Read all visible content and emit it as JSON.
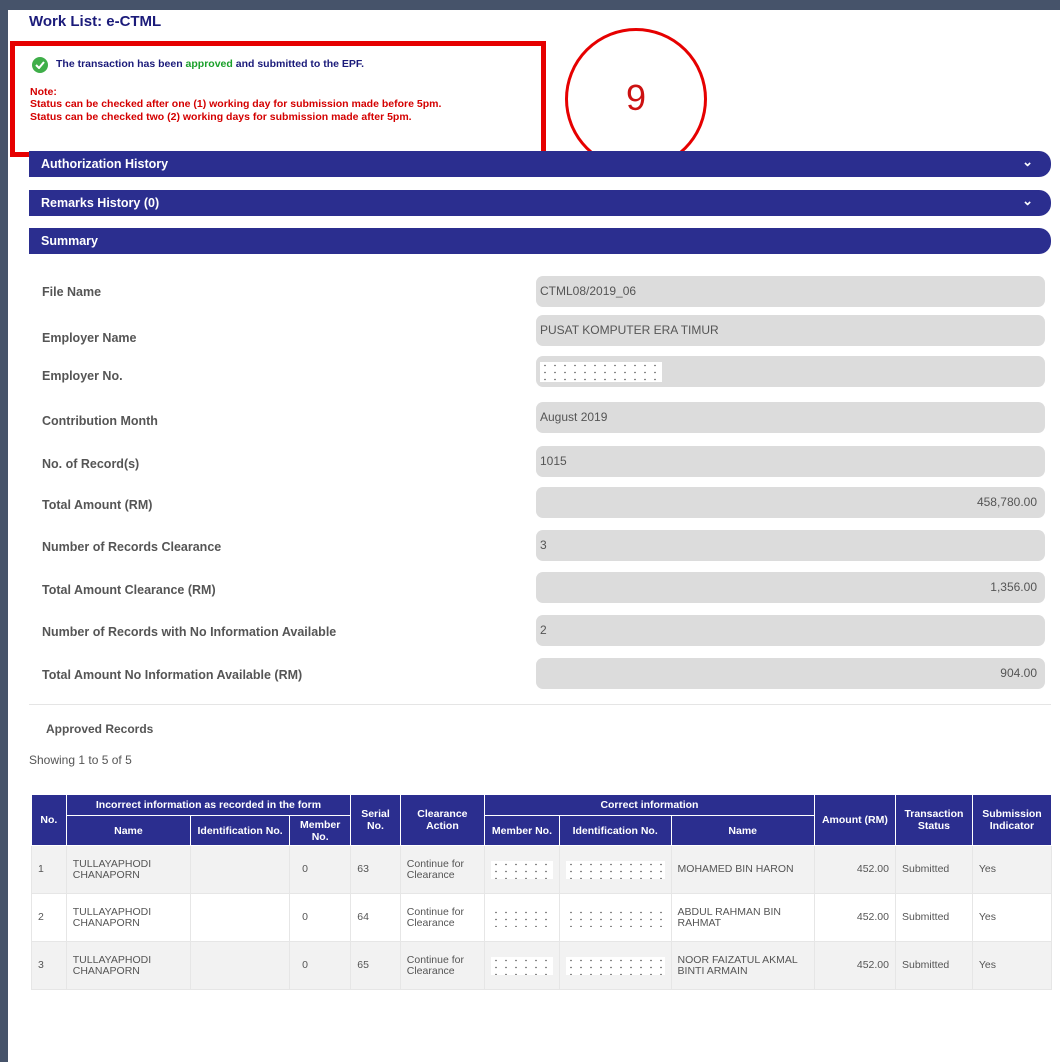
{
  "page": {
    "title": "Work List: e-CTML"
  },
  "alert": {
    "prefix": "The transaction has been ",
    "approved_word": "approved",
    "suffix": " and submitted to the EPF.",
    "note_label": "Note:",
    "note_line_1": "Status can be checked after one (1) working day for submission made before 5pm.",
    "note_line_2": "Status can be checked two (2) working days for submission made after 5pm."
  },
  "step_marker": "9",
  "sections": {
    "authorization": "Authorization History",
    "remarks": "Remarks History (0)",
    "summary": "Summary",
    "chevron": "⌄"
  },
  "summary": {
    "file_name": {
      "label": "File Name",
      "value": "CTML08/2019_06"
    },
    "employer_name": {
      "label": "Employer Name",
      "value": "PUSAT KOMPUTER ERA TIMUR"
    },
    "employer_no": {
      "label": "Employer No.",
      "value": ""
    },
    "contribution_month": {
      "label": "Contribution Month",
      "value": "August 2019"
    },
    "records": {
      "label": "No. of Record(s)",
      "value": "1015"
    },
    "total_amount": {
      "label": "Total Amount (RM)",
      "value": "458,780.00"
    },
    "records_clearance": {
      "label": "Number of Records Clearance",
      "value": "3"
    },
    "amount_clearance": {
      "label": "Total Amount Clearance (RM)",
      "value": "1,356.00"
    },
    "records_no_info": {
      "label": "Number of Records with No Information Available",
      "value": "2"
    },
    "amount_no_info": {
      "label": "Total Amount No Information Available (RM)",
      "value": "904.00"
    }
  },
  "approved": {
    "title": "Approved Records",
    "showing": "Showing 1 to 5 of 5"
  },
  "table": {
    "headers": {
      "no": "No.",
      "incorrect_group": "Incorrect information as recorded in the form",
      "name": "Name",
      "identification_no": "Identification No.",
      "member_no": "Member No.",
      "serial_no": "Serial No.",
      "clearance_action": "Clearance Action",
      "correct_group": "Correct information",
      "correct_member_no": "Member No.",
      "correct_identification_no": "Identification No.",
      "correct_name": "Name",
      "amount": "Amount (RM)",
      "transaction_status": "Transaction Status",
      "submission_indicator": "Submission Indicator"
    },
    "rows": [
      {
        "no": "1",
        "name": "TULLAYAPHODI CHANAPORN",
        "id_no": "",
        "member_no": "0",
        "serial": "63",
        "action": "Continue for Clearance",
        "correct_name": "MOHAMED BIN HARON",
        "amount": "452.00",
        "status": "Submitted",
        "indicator": "Yes"
      },
      {
        "no": "2",
        "name": "TULLAYAPHODI CHANAPORN",
        "id_no": "",
        "member_no": "0",
        "serial": "64",
        "action": "Continue for Clearance",
        "correct_name": "ABDUL RAHMAN BIN RAHMAT",
        "amount": "452.00",
        "status": "Submitted",
        "indicator": "Yes"
      },
      {
        "no": "3",
        "name": "TULLAYAPHODI CHANAPORN",
        "id_no": "",
        "member_no": "0",
        "serial": "65",
        "action": "Continue for Clearance",
        "correct_name": "NOOR FAIZATUL AKMAL BINTI ARMAIN",
        "amount": "452.00",
        "status": "Submitted",
        "indicator": "Yes"
      }
    ]
  },
  "colors": {
    "accent": "#2b2e8f",
    "alert_red": "#e60000",
    "success_green": "#3fae49"
  }
}
